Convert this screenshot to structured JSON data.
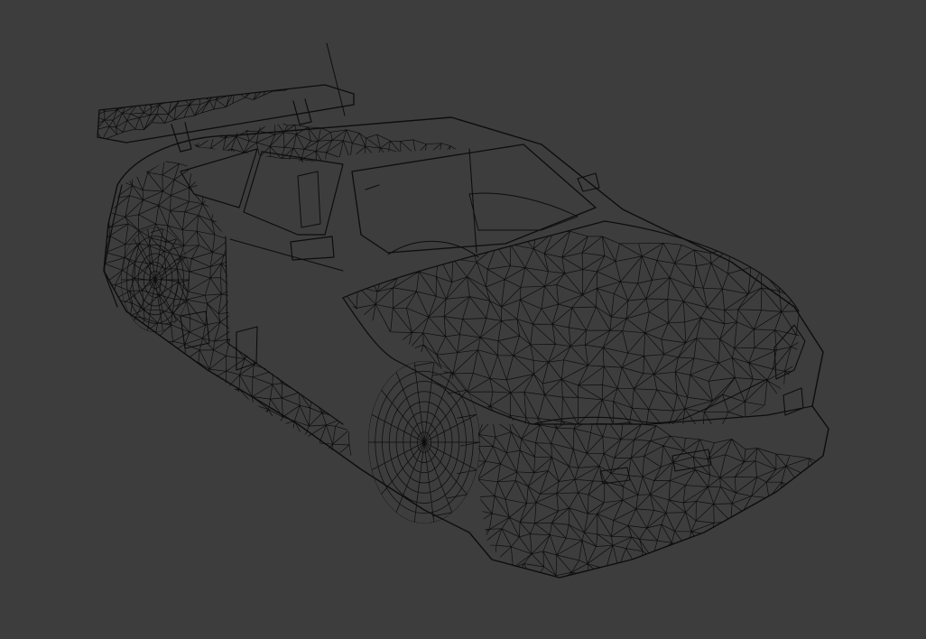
{
  "viewport": {
    "background": "#3d3d3d",
    "wire_color": "#0d0d0d",
    "shading": "wireframe",
    "subject": "sports-car-mesh"
  }
}
